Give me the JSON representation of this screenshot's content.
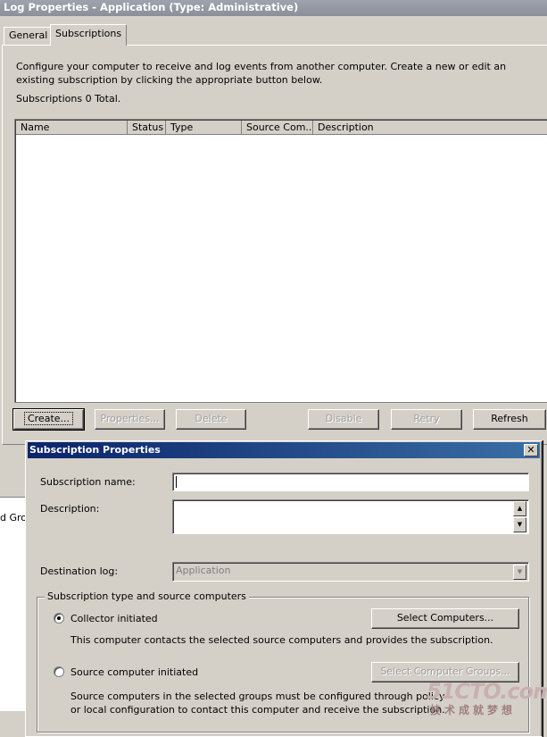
{
  "window": {
    "title": "Log Properties - Application (Type: Administrative)"
  },
  "tabs": [
    {
      "label": "General"
    },
    {
      "label": "Subscriptions"
    }
  ],
  "subscriptions": {
    "description": "Configure your computer to receive and log events from another computer.  Create a new or edit an existing subscription by clicking the appropriate button below.",
    "count_text": "Subscriptions 0 Total.",
    "columns": [
      "Name",
      "Status",
      "Type",
      "Source Com...",
      "Description"
    ],
    "buttons": {
      "create": "Create...",
      "properties": "Properties...",
      "delete": "Delete",
      "disable": "Disable",
      "retry": "Retry",
      "refresh": "Refresh"
    }
  },
  "background_text": "d Grou",
  "dialog": {
    "title": "Subscription Properties",
    "close": "✕",
    "name_label": "Subscription name:",
    "name_value": "",
    "description_label": "Description:",
    "description_value": "",
    "destination_label": "Destination log:",
    "destination_value": "Application",
    "group_label": "Subscription type and source computers",
    "collector_label": "Collector initiated",
    "collector_selected": true,
    "select_computers": "Select Computers...",
    "collector_help": "This computer contacts the selected source computers and provides the subscription.",
    "source_label": "Source computer initiated",
    "source_selected": false,
    "select_groups": "Select Computer Groups...",
    "source_help": "Source computers in the selected groups must be configured through policy or local configuration to contact this computer and receive the subscription."
  },
  "watermark": {
    "logo": "51CTO.com",
    "sub": "技术成就梦想"
  },
  "icons": {
    "spin_up": "triangle-up-icon",
    "spin_down": "triangle-down-icon",
    "dropdown": "chevron-down-icon"
  },
  "colors": {
    "face": "#d4d0c8",
    "active_title": "#0a246a",
    "inactive_title": "#9ea3ad"
  }
}
